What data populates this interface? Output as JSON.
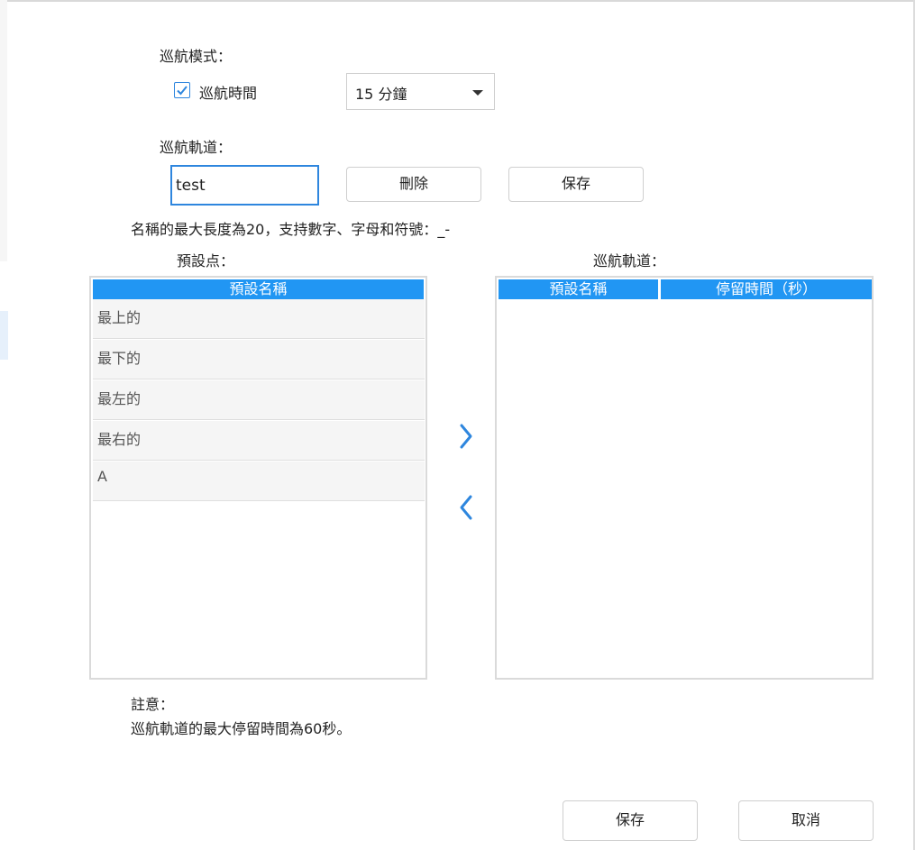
{
  "cruise_mode": {
    "label": "巡航模式：",
    "time_checkbox_label": "巡航時間",
    "time_checked": true,
    "time_select_value": "15 分鐘"
  },
  "track": {
    "label": "巡航軌道：",
    "name_value": "test",
    "delete_label": "刪除",
    "save_label": "保存",
    "hint": "名稱的最大長度為20，支持數字、字母和符號：_-"
  },
  "presets": {
    "title": "預設点：",
    "column": "預設名稱",
    "items": [
      "最上的",
      "最下的",
      "最左的",
      "最右的",
      "A"
    ]
  },
  "cruise_track": {
    "title": "巡航軌道：",
    "columns": [
      "預設名稱",
      "停留時間（秒）"
    ]
  },
  "icons": {
    "add": "chevron-right-icon",
    "remove": "chevron-left-icon",
    "accent_color": "#2196f3"
  },
  "note": {
    "title": "註意：",
    "text": "巡航軌道的最大停留時間為60秒。"
  },
  "footer": {
    "save_label": "保存",
    "cancel_label": "取消"
  }
}
